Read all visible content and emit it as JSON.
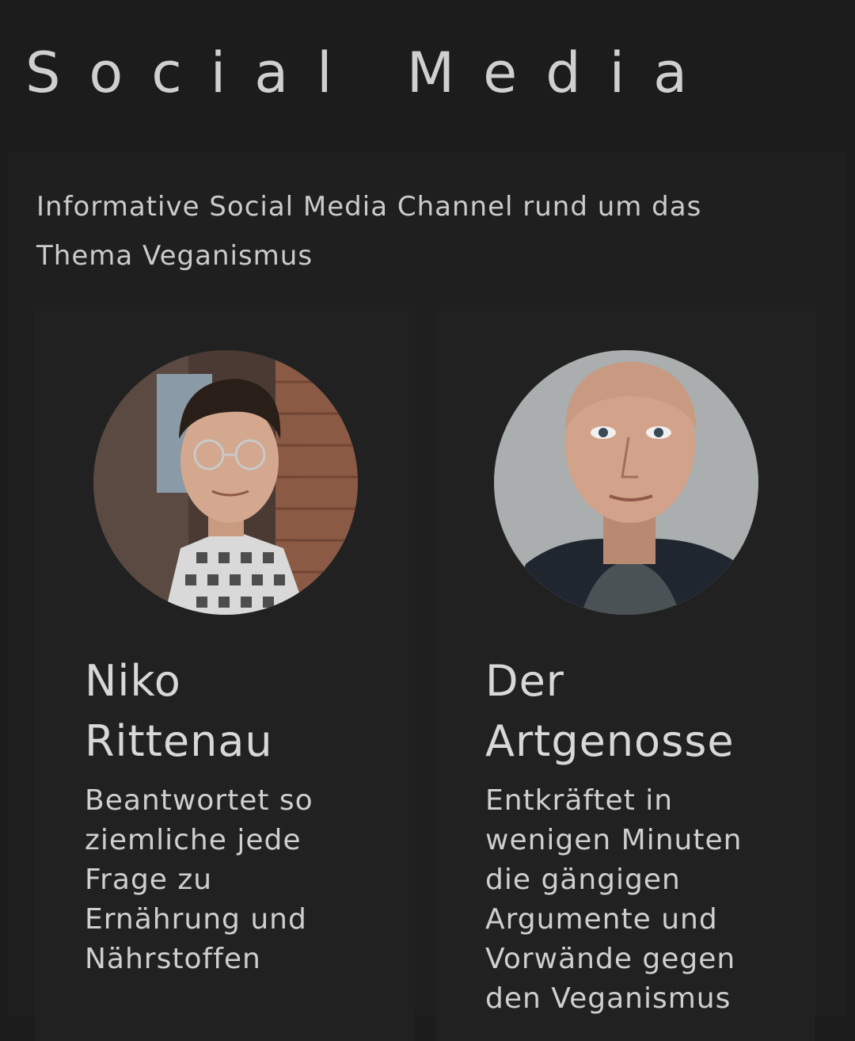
{
  "page": {
    "title": "Social Media",
    "intro_lines": [
      "Informative Social Media Channel rund um das",
      "Thema Veganismus"
    ]
  },
  "cards": [
    {
      "name_lines": [
        "Niko",
        "Rittenau"
      ],
      "description_lines": [
        "Beantwortet so",
        "ziemliche jede",
        "Frage zu",
        "Ernährung und",
        "Nährstoffen"
      ],
      "avatar_icon": "portrait-photo"
    },
    {
      "name_lines": [
        "Der",
        "Artgenosse"
      ],
      "description_lines": [
        "Entkräftet in",
        "wenigen Minuten",
        "die gängigen",
        "Argumente und",
        "Vorwände gegen",
        "den Veganismus"
      ],
      "avatar_icon": "portrait-photo"
    }
  ],
  "colors": {
    "background": "#1c1c1c",
    "section": "#1f1f1f",
    "card": "#212121",
    "text": "#d6d6d6"
  }
}
